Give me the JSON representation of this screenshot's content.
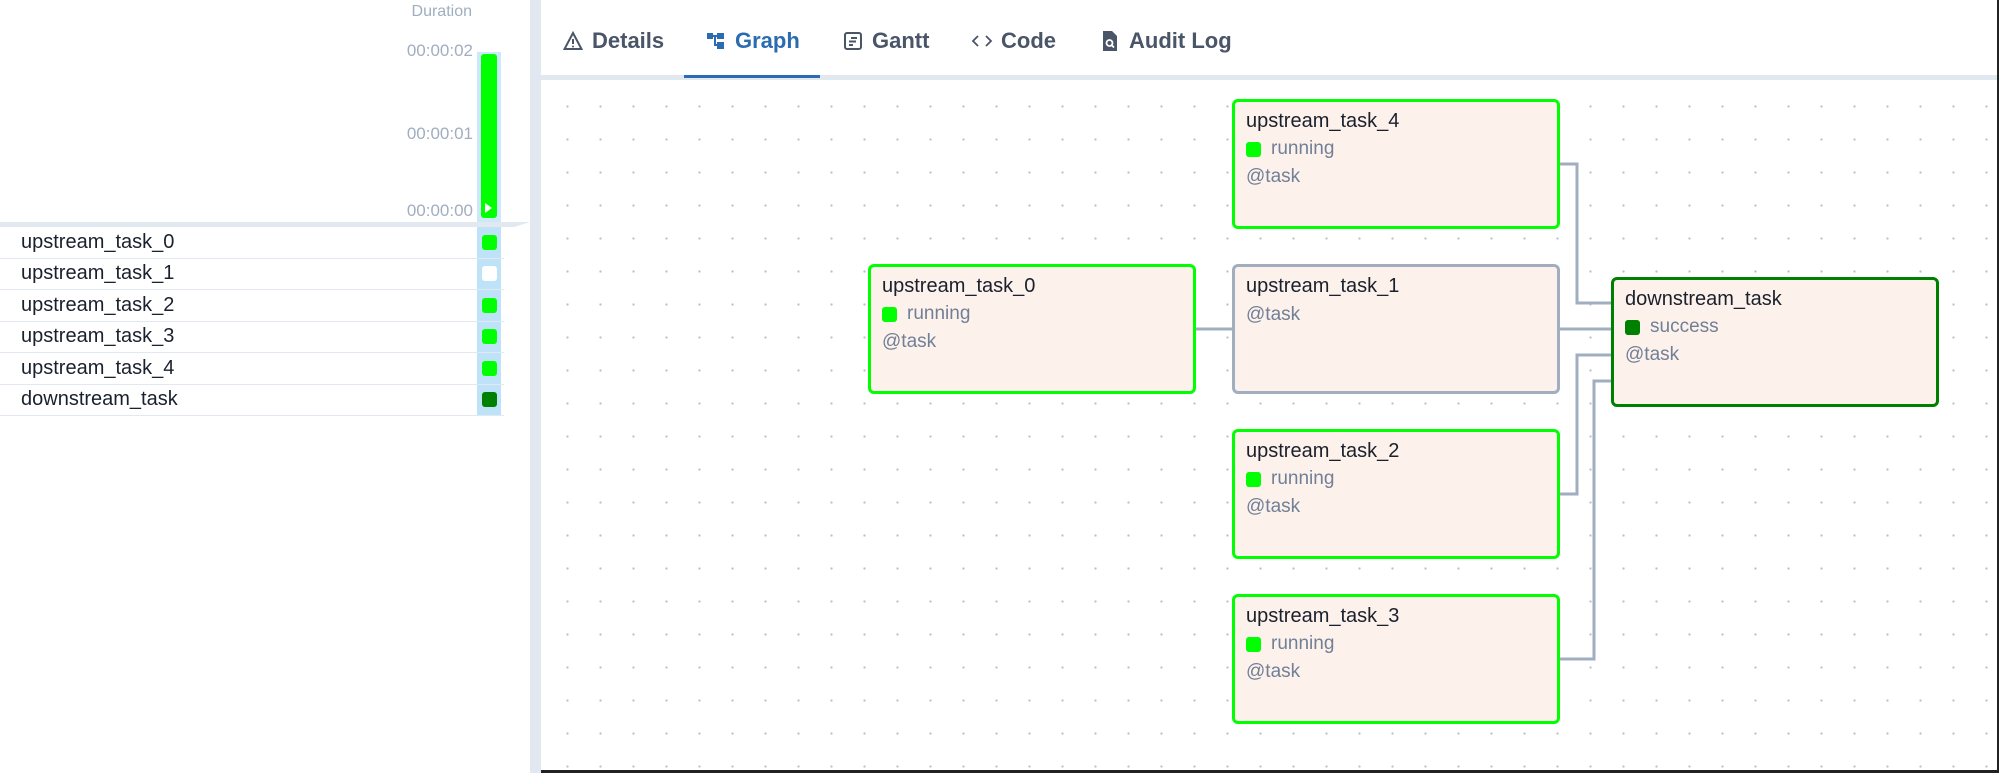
{
  "left_panel": {
    "duration_header": "Duration",
    "ticks": [
      "00:00:02",
      "00:00:01",
      "00:00:00"
    ],
    "run_bar": {
      "state": "running",
      "color": "#00ff00",
      "duration_fraction_of_axis": 1.0
    },
    "tasks": [
      {
        "label": "upstream_task_0",
        "state": "running",
        "color": "#00ff00"
      },
      {
        "label": "upstream_task_1",
        "state": "none",
        "color": "#ffffff"
      },
      {
        "label": "upstream_task_2",
        "state": "running",
        "color": "#00ff00"
      },
      {
        "label": "upstream_task_3",
        "state": "running",
        "color": "#00ff00"
      },
      {
        "label": "upstream_task_4",
        "state": "running",
        "color": "#00ff00"
      },
      {
        "label": "downstream_task",
        "state": "success",
        "color": "#008000"
      }
    ]
  },
  "tabs": [
    {
      "label": "Details",
      "icon": "warning-triangle-icon",
      "active": false
    },
    {
      "label": "Graph",
      "icon": "graph-icon",
      "active": true
    },
    {
      "label": "Gantt",
      "icon": "gantt-icon",
      "active": false
    },
    {
      "label": "Code",
      "icon": "code-icon",
      "active": false
    },
    {
      "label": "Audit Log",
      "icon": "audit-log-icon",
      "active": false
    }
  ],
  "graph": {
    "nodes": [
      {
        "id": "upstream_task_0",
        "title": "upstream_task_0",
        "status": "running",
        "status_color": "#00ff00",
        "operator": "@task"
      },
      {
        "id": "upstream_task_4",
        "title": "upstream_task_4",
        "status": "running",
        "status_color": "#00ff00",
        "operator": "@task"
      },
      {
        "id": "upstream_task_1",
        "title": "upstream_task_1",
        "status": "",
        "status_color": "",
        "operator": "@task"
      },
      {
        "id": "upstream_task_2",
        "title": "upstream_task_2",
        "status": "running",
        "status_color": "#00ff00",
        "operator": "@task"
      },
      {
        "id": "upstream_task_3",
        "title": "upstream_task_3",
        "status": "running",
        "status_color": "#00ff00",
        "operator": "@task"
      },
      {
        "id": "downstream_task",
        "title": "downstream_task",
        "status": "success",
        "status_color": "#008000",
        "operator": "@task"
      }
    ],
    "edges": [
      {
        "from": "upstream_task_0",
        "to": "upstream_task_1"
      },
      {
        "from": "upstream_task_4",
        "to": "downstream_task"
      },
      {
        "from": "upstream_task_1",
        "to": "downstream_task"
      },
      {
        "from": "upstream_task_2",
        "to": "downstream_task"
      },
      {
        "from": "upstream_task_3",
        "to": "downstream_task"
      }
    ]
  },
  "colors": {
    "accent": "#2b6cb0",
    "running": "#00ff00",
    "success": "#008000",
    "no_status": "#a0aec0",
    "node_bg": "#fdf1ec"
  }
}
